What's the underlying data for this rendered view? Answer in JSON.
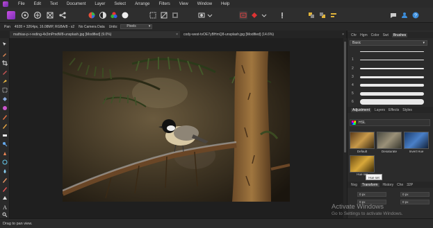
{
  "menubar": {
    "items": [
      "File",
      "Edit",
      "Text",
      "Document",
      "Layer",
      "Select",
      "Arrange",
      "Filters",
      "View",
      "Window",
      "Help"
    ]
  },
  "context": {
    "pan_label": "Pan",
    "doc_info": "4928 × 3264px, 16.08MP, RGBA/8 - s2",
    "camera": "No Camera Data",
    "units_label": "Units:",
    "units_value": "Pixels"
  },
  "tabs": [
    {
      "label": "mathias-p-r-reding-4x3mPmdW8-unsplash.jpg [Modified] (9.0%)",
      "active": true
    },
    {
      "label": "cody-west-tvOE7yBHmQ8-unsplash.jpg [Modified] (14.6%)",
      "active": false
    }
  ],
  "right_panel": {
    "top_tabs": [
      "Chr",
      "Hgm",
      "Color",
      "Swt",
      "Brushes"
    ],
    "active_top_tab": "Brushes",
    "brush_category": "Basic",
    "brushes": [
      {
        "num": "1"
      },
      {
        "num": "2"
      },
      {
        "num": "3"
      },
      {
        "num": "4"
      },
      {
        "num": "5"
      },
      {
        "num": "6"
      }
    ],
    "mid_tabs": [
      "Adjustment",
      "Layers",
      "Effects",
      "Styles"
    ],
    "active_mid_tab": "Adjustment",
    "adjustment_name": "HSL",
    "presets": [
      "Default",
      "Desaturate",
      "Invert Hue",
      "Hue set"
    ],
    "tooltip": "Hue set",
    "bottom_tabs": [
      "Nvg",
      "Transform",
      "History",
      "Chn",
      "32P"
    ],
    "active_bottom_tab": "Transform",
    "transform_values": [
      "0 px",
      "0 px",
      "0 px",
      "0 px"
    ]
  },
  "watermark": {
    "title": "Activate Windows",
    "subtitle": "Go to Settings to activate Windows."
  },
  "status": {
    "text": "Drag to pan view."
  },
  "colors": {
    "accent": "#3c8ddb",
    "app_brand": "#a93fc4"
  }
}
